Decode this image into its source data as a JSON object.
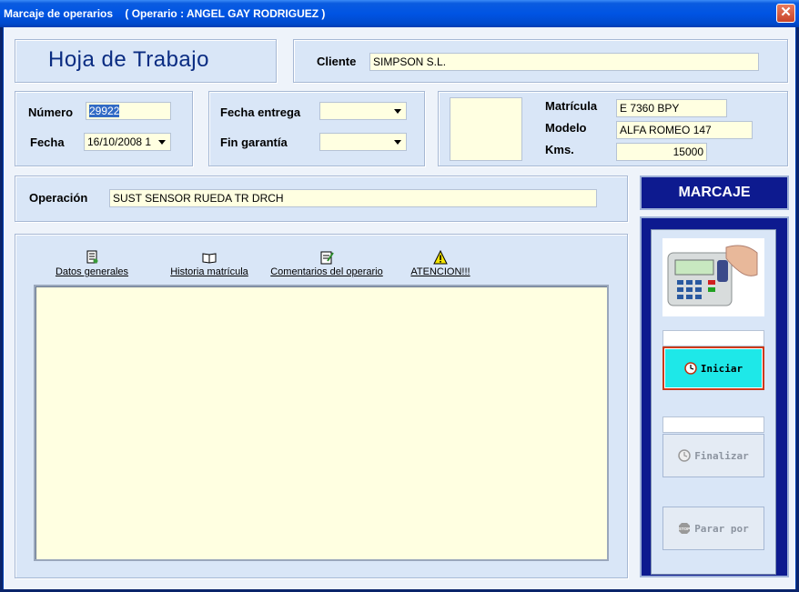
{
  "window": {
    "title": "Marcaje de operarios    ( Operario : ANGEL GAY RODRIGUEZ )",
    "close_glyph": "✕"
  },
  "header": {
    "title": "Hoja de Trabajo"
  },
  "cliente": {
    "label": "Cliente",
    "value": "SIMPSON S.L."
  },
  "numero": {
    "label": "Número",
    "value": "29922"
  },
  "fecha": {
    "label": "Fecha",
    "value": "16/10/2008 1"
  },
  "fecha_entrega": {
    "label": "Fecha entrega",
    "value": ""
  },
  "fin_garantia": {
    "label": "Fin garantía",
    "value": ""
  },
  "vehiculo": {
    "matricula_label": "Matrícula",
    "matricula": "E 7360 BPY",
    "modelo_label": "Modelo",
    "modelo": "ALFA ROMEO 147",
    "kms_label": "Kms.",
    "kms": "15000"
  },
  "operacion": {
    "label": "Operación",
    "value": "SUST SENSOR RUEDA TR DRCH"
  },
  "tabs": [
    {
      "label": "Datos generales",
      "icon": "document-icon"
    },
    {
      "label": "Historia matrícula",
      "icon": "book-icon"
    },
    {
      "label": "Comentarios del operario",
      "icon": "notepad-icon"
    },
    {
      "label": "ATENCION!!!",
      "icon": "warning-icon"
    }
  ],
  "marcaje": {
    "title": "MARCAJE",
    "iniciar": "Iniciar",
    "finalizar": "Finalizar",
    "parar": "Parar por",
    "stop_text": "STOP"
  },
  "colors": {
    "accent": "#0d1a8f",
    "active_button": "#1ee8e8",
    "field_bg": "#ffffe1"
  }
}
